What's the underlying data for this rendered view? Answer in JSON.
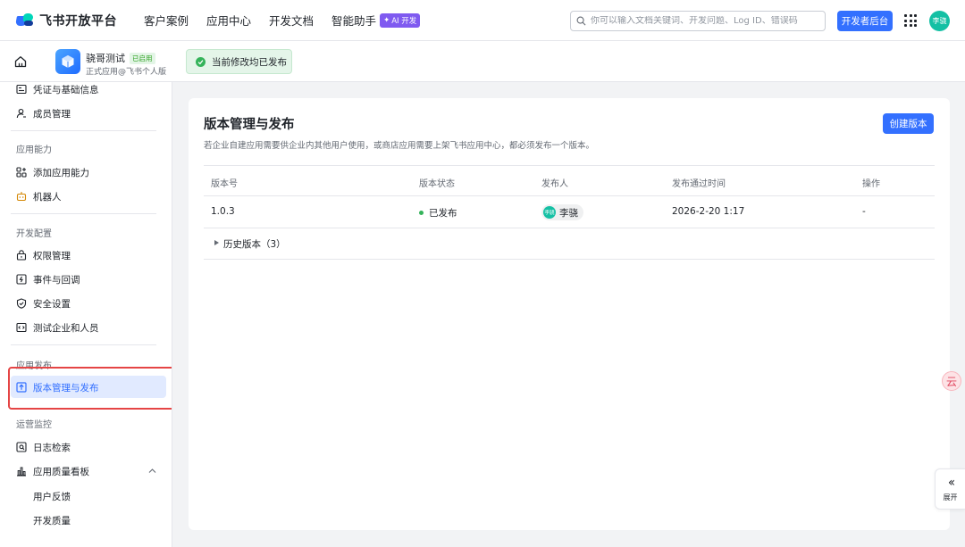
{
  "topnav": {
    "logo_text": "飞书开放平台",
    "items": [
      "客户案例",
      "应用中心",
      "开发文档",
      "智能助手"
    ],
    "ai_badge": "AI 开发",
    "search_placeholder": "你可以输入文档关键词、开发问题、Log ID、错误码",
    "dev_console": "开发者后台",
    "avatar": "李骁"
  },
  "app": {
    "name": "骁哥测试",
    "status_badge": "已启用",
    "subtitle": "正式应用@飞书个人版",
    "published_notice": "当前修改均已发布"
  },
  "sidebar": {
    "items": {
      "credentials": "凭证与基础信息",
      "members": "成员管理",
      "add_ability": "添加应用能力",
      "bot": "机器人",
      "permissions": "权限管理",
      "events": "事件与回调",
      "security": "安全设置",
      "test_enterprise": "测试企业和人员",
      "version_release": "版本管理与发布",
      "log_search": "日志检索",
      "quality_board": "应用质量看板",
      "user_feedback": "用户反馈",
      "dev_quality": "开发质量"
    },
    "groups": {
      "abilities": "应用能力",
      "dev_config": "开发配置",
      "release": "应用发布",
      "ops": "运营监控"
    }
  },
  "main": {
    "title": "版本管理与发布",
    "description": "若企业自建应用需要供企业内其他用户使用，或商店应用需要上架飞书应用中心，都必须发布一个版本。",
    "create_button": "创建版本",
    "columns": [
      "版本号",
      "版本状态",
      "发布人",
      "发布通过时间",
      "操作"
    ],
    "rows": [
      {
        "version": "1.0.3",
        "status": "已发布",
        "publisher": "李骁",
        "publisher_avatar": "李骁",
        "time": "2026-2-20 1:17",
        "action": "-"
      }
    ],
    "history": "历史版本（3）"
  },
  "floating": {
    "expand_label": "展开",
    "fab_glyph": "云"
  },
  "colors": {
    "primary": "#3370ff",
    "success": "#34b35a",
    "highlight": "#e54545",
    "avatar": "#14c0a4"
  }
}
